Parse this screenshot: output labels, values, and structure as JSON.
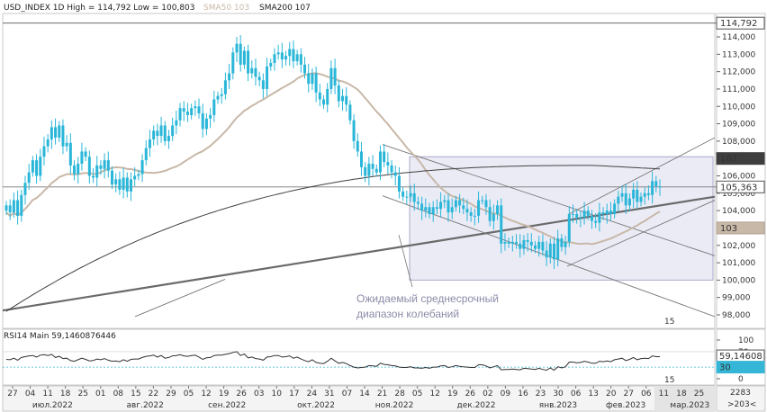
{
  "header": {
    "symbol_line": "USD_INDEX 1D High = 114,792 Low = 100,803",
    "sma50_label": "SMA50 103",
    "sma200_label": "SMA200 107"
  },
  "rsi_header": "RSI14 Main 59,1460876446",
  "annotation": [
    "Ожидаемый среднесрочный",
    "диапазон колебаний"
  ],
  "colors": {
    "candle": "#29b6d8",
    "sma50": "#c8b8a8",
    "sma200": "#404040",
    "rsi": "#303030",
    "range_fill": "#ebebf6",
    "range_stroke": "#a9a9c9",
    "trend": "#777777"
  },
  "chart_data": {
    "type": "candlestick",
    "ylim": [
      97.9,
      115.3
    ],
    "y_ticks": [
      "114,000",
      "113,000",
      "112,000",
      "111,000",
      "110,000",
      "109,000",
      "108,000",
      "107,000",
      "106,000",
      "105,000",
      "104,000",
      "103,000",
      "102,000",
      "101,000",
      "100,000",
      "99,000",
      "98,000"
    ],
    "y_tick_values": [
      114,
      113,
      112,
      111,
      110,
      109,
      108,
      107,
      106,
      105,
      104,
      103,
      102,
      101,
      100,
      99,
      98
    ],
    "price_markers": [
      {
        "label": "114,792",
        "value": 114.792,
        "style": "white"
      },
      {
        "label": "107",
        "value": 107.0,
        "style": "dark"
      },
      {
        "label": "105,363",
        "value": 105.363,
        "style": "white"
      },
      {
        "label": "103",
        "value": 103.0,
        "style": "sand"
      }
    ],
    "close": [
      104.3,
      103.9,
      104.6,
      103.7,
      104.9,
      105.6,
      106.2,
      106.9,
      106.0,
      107.1,
      107.7,
      108.1,
      108.8,
      108.2,
      108.9,
      107.7,
      107.9,
      106.6,
      106.1,
      106.7,
      107.4,
      107.1,
      106.0,
      105.9,
      106.6,
      106.4,
      106.9,
      106.3,
      105.5,
      105.8,
      105.2,
      105.9,
      105.1,
      105.8,
      106.0,
      106.1,
      106.9,
      107.6,
      108.1,
      108.6,
      108.3,
      108.9,
      108.0,
      108.3,
      108.9,
      109.2,
      109.9,
      109.7,
      109.5,
      109.9,
      110.0,
      109.6,
      108.7,
      109.3,
      109.5,
      110.4,
      110.6,
      110.7,
      111.5,
      111.9,
      113.1,
      113.6,
      112.4,
      113.2,
      111.9,
      112.2,
      111.7,
      111.5,
      111.0,
      112.3,
      112.5,
      113.0,
      113.1,
      112.7,
      112.9,
      113.3,
      112.6,
      113.0,
      112.4,
      111.9,
      111.3,
      111.9,
      110.8,
      110.4,
      110.1,
      111.0,
      112.2,
      111.2,
      110.3,
      110.6,
      110.1,
      109.2,
      108.0,
      107.4,
      106.5,
      106.0,
      106.7,
      106.4,
      106.2,
      107.4,
      106.8,
      106.6,
      106.2,
      106.0,
      105.1,
      104.8,
      104.8,
      105.0,
      104.5,
      104.4,
      104.0,
      104.2,
      103.8,
      104.2,
      104.1,
      104.5,
      104.6,
      103.9,
      104.2,
      104.6,
      104.3,
      104.1,
      103.9,
      103.7,
      103.7,
      104.6,
      104.6,
      104.2,
      103.4,
      103.8,
      104.3,
      102.1,
      102.2,
      102.1,
      102.2,
      102.1,
      101.8,
      102.3,
      102.2,
      102.0,
      101.8,
      102.2,
      101.7,
      101.3,
      102.1,
      101.2,
      102.4,
      101.9,
      102.2,
      103.8,
      103.8,
      103.6,
      103.6,
      104.0,
      103.7,
      103.4,
      103.3,
      103.9,
      103.8,
      104.0,
      103.8,
      104.4,
      104.8,
      105.0,
      104.3,
      104.7,
      105.2,
      104.5,
      104.8,
      105.0,
      104.9,
      105.7,
      105.4,
      105.4
    ]
  },
  "rsi_chart": {
    "ylim": [
      0,
      100
    ],
    "y_ticks": [
      "100",
      "70",
      "30",
      "0"
    ],
    "y_tick_values": [
      100,
      70,
      30,
      0
    ],
    "markers": [
      {
        "label": "59,14608",
        "value": 59.146
      },
      {
        "label": "30",
        "value": 30
      }
    ],
    "values": [
      50,
      49,
      53,
      48,
      55,
      57,
      59,
      60,
      56,
      61,
      62,
      60,
      63,
      55,
      58,
      52,
      53,
      47,
      45,
      49,
      53,
      50,
      46,
      47,
      51,
      49,
      52,
      48,
      45,
      46,
      44,
      49,
      45,
      50,
      51,
      51,
      55,
      58,
      59,
      61,
      56,
      60,
      53,
      55,
      59,
      60,
      62,
      59,
      58,
      60,
      61,
      56,
      50,
      54,
      55,
      60,
      61,
      61,
      63,
      65,
      68,
      70,
      60,
      64,
      54,
      56,
      52,
      51,
      48,
      56,
      57,
      60,
      60,
      56,
      57,
      59,
      53,
      56,
      51,
      47,
      44,
      49,
      42,
      40,
      39,
      45,
      53,
      46,
      40,
      42,
      39,
      34,
      30,
      28,
      29,
      30,
      34,
      33,
      32,
      40,
      37,
      36,
      34,
      33,
      30,
      29,
      29,
      31,
      28,
      28,
      27,
      29,
      27,
      30,
      30,
      33,
      34,
      29,
      31,
      34,
      32,
      31,
      30,
      29,
      29,
      36,
      36,
      33,
      28,
      31,
      34,
      23,
      24,
      24,
      25,
      24,
      23,
      27,
      26,
      25,
      24,
      27,
      24,
      22,
      28,
      22,
      31,
      28,
      31,
      43,
      43,
      41,
      42,
      45,
      43,
      40,
      40,
      45,
      44,
      46,
      44,
      49,
      51,
      53,
      47,
      50,
      55,
      49,
      52,
      53,
      52,
      59,
      57,
      57
    ]
  },
  "time_axis": {
    "day_labels": [
      "27",
      "04",
      "11",
      "18",
      "25",
      "01",
      "08",
      "15",
      "22",
      "29",
      "05",
      "12",
      "19",
      "26",
      "03",
      "10",
      "17",
      "24",
      "31",
      "07",
      "14",
      "21",
      "28",
      "05",
      "12",
      "19",
      "26",
      "02",
      "09",
      "16",
      "23",
      "30",
      "06",
      "13",
      "20",
      "27",
      "06"
    ],
    "future_labels": [
      "11",
      "18",
      "25"
    ],
    "month_labels": [
      {
        "label": "июл.2022",
        "frac": 0.07
      },
      {
        "label": "авг.2022",
        "frac": 0.2
      },
      {
        "label": "сен.2022",
        "frac": 0.315
      },
      {
        "label": "окт.2022",
        "frac": 0.44
      },
      {
        "label": "ноя.2022",
        "frac": 0.55
      },
      {
        "label": "дек.2022",
        "frac": 0.665
      },
      {
        "label": "янв.2023",
        "frac": 0.78
      },
      {
        "label": "фев.2023",
        "frac": 0.875
      },
      {
        "label": "мар.2023",
        "frac": 0.965
      }
    ],
    "counter_top": "2283",
    "counter_bottom": ">203<",
    "scroll_marker": "15"
  }
}
